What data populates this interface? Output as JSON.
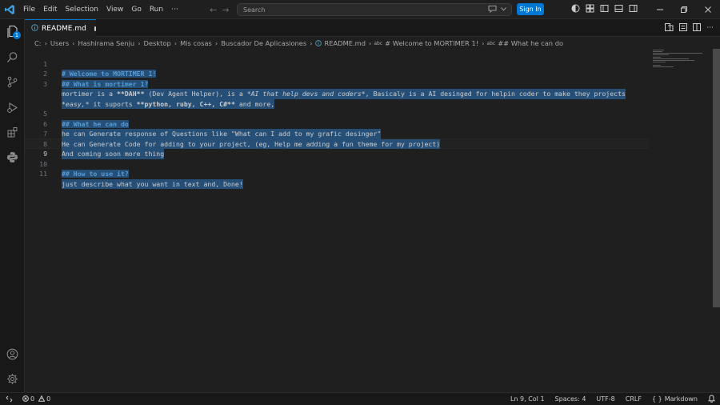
{
  "titlebar": {
    "menu": [
      "File",
      "Edit",
      "Selection",
      "View",
      "Go",
      "Run",
      "···"
    ],
    "search_placeholder": "Search",
    "sign_in_label": "Sign In"
  },
  "activity": {
    "explorer_badge": "1"
  },
  "tabs": [
    {
      "label": "README.md",
      "modified": true
    }
  ],
  "breadcrumb": [
    "C:",
    "Users",
    "Hashirama Senju",
    "Desktop",
    "Mis cosas",
    "Buscador De Aplicasiones",
    "README.md",
    "# Welcome to MORTIMER 1!",
    "## What he can do"
  ],
  "editor": {
    "line_numbers": [
      "1",
      "2",
      "3",
      "",
      "5",
      "6",
      "7",
      "8",
      "9",
      "10",
      "11"
    ],
    "active_line": "9"
  },
  "code": {
    "l1": "# Welcome to MORTIMER 1!",
    "l2": "## What is mortimer 1?",
    "l3a": "mortimer is a ",
    "l3b": "**DAH**",
    "l3c": " (Dev Agent Helper), is a ",
    "l3d": "*AI that help devs and coders*",
    "l3e": ", Basicaly is a AI desinged for helpin coder to make they projects",
    "l4a": "*easy,*",
    "l4b": " it suports ",
    "l4c": "**python, ruby, C++, C#**",
    "l4d": " and more,",
    "l5": "## What he can do",
    "l6": "he can Generate response of Questions like \"What can I add to my grafic desinger\"",
    "l7": "He can Generate Code for adding to your project, (eg, Help me adding a fun theme for my project)",
    "l8": "And coming soon more thing",
    "l10": "## How to use it?",
    "l11": "just describe what you want in text and, Done!"
  },
  "status": {
    "errors": "0",
    "warnings": "0",
    "position": "Ln 9, Col 1",
    "spaces": "Spaces: 4",
    "encoding": "UTF-8",
    "eol": "CRLF",
    "language_icon": "{ }",
    "language": "Markdown"
  },
  "colors": {
    "accent": "#0078d4",
    "heading": "#569cd6",
    "selection": "#264f78"
  }
}
